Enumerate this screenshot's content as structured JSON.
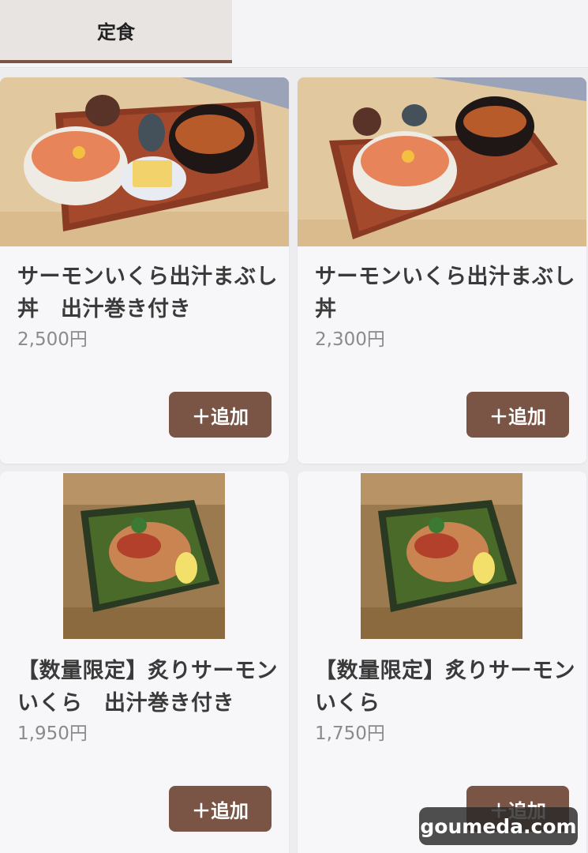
{
  "tabs": {
    "active_label": "定食"
  },
  "colors": {
    "accent": "#7a5444",
    "background": "#ededf0",
    "card": "#f7f7f9"
  },
  "products": [
    {
      "title": "サーモンいくら出汁まぶし丼　出汁巻き付き",
      "price": "2,500円",
      "add_label": "＋追加",
      "image": "salmon-ikura-donburi-set-with-dashimaki-photo"
    },
    {
      "title": "サーモンいくら出汁まぶし丼",
      "price": "2,300円",
      "add_label": "＋追加",
      "image": "salmon-ikura-donburi-set-photo"
    },
    {
      "title": "【数量限定】炙りサーモンいくら　出汁巻き付き",
      "price": "1,950円",
      "add_label": "＋追加",
      "image": "aburi-salmon-ikura-plate-photo"
    },
    {
      "title": "【数量限定】炙りサーモンいくら",
      "price": "1,750円",
      "add_label": "＋追加",
      "image": "aburi-salmon-ikura-plate-photo"
    }
  ],
  "watermark": "goumeda.com"
}
